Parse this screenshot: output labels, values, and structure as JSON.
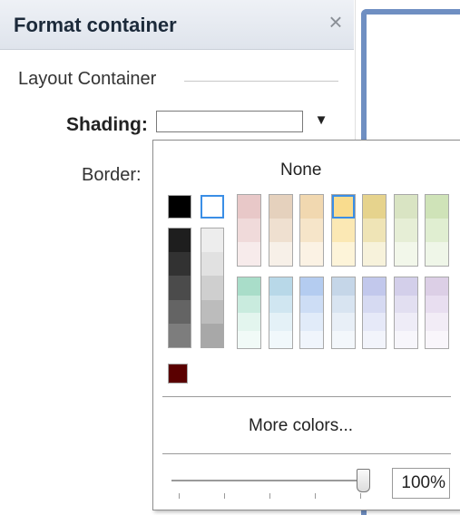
{
  "panel": {
    "title": "Format container",
    "close_label": "×",
    "section_title": "Layout Container",
    "shading_label": "Shading:",
    "border_label": "Border:",
    "shading_dropdown_arrow": "▼"
  },
  "color_picker": {
    "none_label": "None",
    "more_colors_label": "More colors...",
    "transparency_value": "100%",
    "slider_level_percent": 100,
    "selected_color": "#f9dc8e",
    "top_row": [
      "#000000",
      "#ffffff"
    ],
    "grayscale_strips": [
      [
        "#1e1e1e",
        "#323232",
        "#4b4b4b",
        "#646464",
        "#7d7d7d"
      ],
      [
        "#ededed",
        "#e1e1e1",
        "#cfcfcf",
        "#bcbcbc",
        "#a8a8a8"
      ]
    ],
    "dark_swatch": "#5a0000",
    "warm_columns": [
      [
        "#e8c8c8",
        "#f0dada",
        "#f7ebeb"
      ],
      [
        "#e5d1bd",
        "#efe0d0",
        "#f7f0e8"
      ],
      [
        "#f1d8b0",
        "#f6e5c9",
        "#fbf2e4"
      ],
      [
        "#f9dc8e",
        "#fbe8b4",
        "#fdf4d9"
      ],
      [
        "#e6d38d",
        "#efe4b6",
        "#f7f2db"
      ],
      [
        "#d9e4c3",
        "#e6eed6",
        "#f2f7ea"
      ],
      [
        "#cfe3b8",
        "#e0eed1",
        "#eff6e8"
      ]
    ],
    "cool_columns": [
      [
        "#a9ddc9",
        "#c9ebde",
        "#e3f5ee",
        "#f1faf7"
      ],
      [
        "#b8d8e8",
        "#d0e6f1",
        "#e4f1f7",
        "#f1f8fb"
      ],
      [
        "#b4ccf0",
        "#cdddf5",
        "#e1ebf9",
        "#f0f5fc"
      ],
      [
        "#c5d6e8",
        "#d8e4f1",
        "#e8eff7",
        "#f3f7fb"
      ],
      [
        "#c2c8ec",
        "#d6daf2",
        "#e6e9f8",
        "#f2f4fb"
      ],
      [
        "#d3cfea",
        "#e2dff1",
        "#eeecf7",
        "#f7f6fb"
      ],
      [
        "#dccfe6",
        "#e8def0",
        "#f2ecf6",
        "#f9f6fb"
      ]
    ]
  }
}
